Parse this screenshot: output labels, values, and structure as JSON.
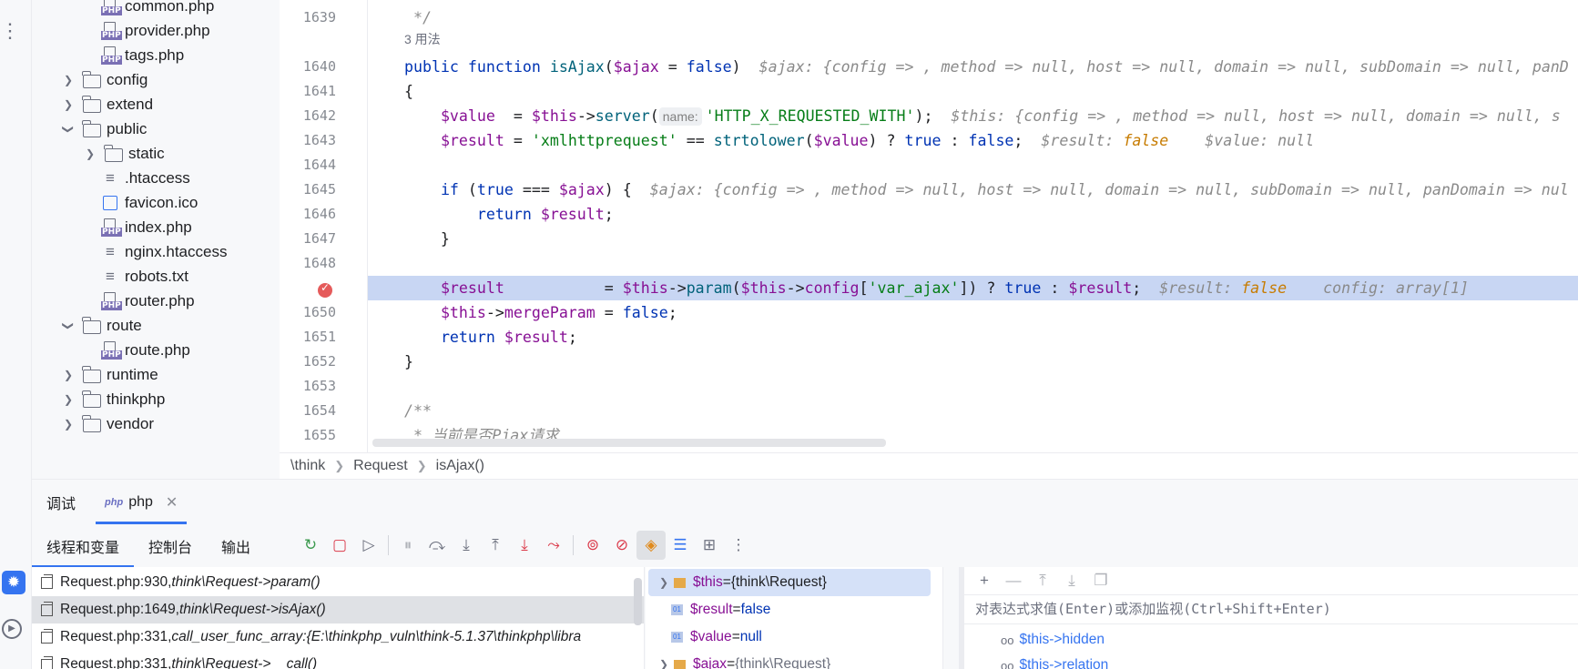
{
  "tree": {
    "items": [
      {
        "label": "common.php",
        "type": "php"
      },
      {
        "label": "provider.php",
        "type": "php"
      },
      {
        "label": "tags.php",
        "type": "php"
      },
      {
        "label": "config",
        "type": "folder"
      },
      {
        "label": "extend",
        "type": "folder"
      },
      {
        "label": "public",
        "type": "folder",
        "expanded": true
      },
      {
        "label": "static",
        "type": "folder"
      },
      {
        "label": ".htaccess",
        "type": "text"
      },
      {
        "label": "favicon.ico",
        "type": "image"
      },
      {
        "label": "index.php",
        "type": "php"
      },
      {
        "label": "nginx.htaccess",
        "type": "text"
      },
      {
        "label": "robots.txt",
        "type": "text"
      },
      {
        "label": "router.php",
        "type": "php"
      },
      {
        "label": "route",
        "type": "folder",
        "expanded": true
      },
      {
        "label": "route.php",
        "type": "php"
      },
      {
        "label": "runtime",
        "type": "folder"
      },
      {
        "label": "thinkphp",
        "type": "folder"
      },
      {
        "label": "vendor",
        "type": "folder"
      }
    ],
    "php_badge": "PHP"
  },
  "editor": {
    "line_numbers": [
      "1639",
      "1640",
      "1641",
      "1642",
      "1643",
      "1644",
      "1645",
      "1646",
      "1647",
      "1648",
      "1649",
      "1650",
      "1651",
      "1652",
      "1653",
      "1654",
      "1655"
    ],
    "usage_hint": "3 用法",
    "name_hint": "name:",
    "inline": {
      "l1640": "$ajax: {config => , method => null, host => null, domain => null, subDomain => null, panD",
      "l1642": "$this: {config => , method => null, host => null, domain => null, s",
      "l1643_result": "$result: ",
      "l1643_result_val": "false",
      "l1643_value": "$value: null",
      "l1645": "$ajax: {config => , method => null, host => null, domain => null, subDomain => null, panDomain => nul",
      "l1649_result": "$result: ",
      "l1649_result_val": "false",
      "l1649_config": "config: array[1]"
    },
    "comment_1655": " * 当前是否Pjax请求"
  },
  "breadcrumb": [
    "\\think",
    "Request",
    "isAjax()"
  ],
  "debug": {
    "tab_debug": "调试",
    "tab_php": "php",
    "php_logo": "php",
    "subtabs": [
      "线程和变量",
      "控制台",
      "输出"
    ],
    "frames": [
      {
        "loc": "Request.php:930, ",
        "fn": "think\\Request->param()"
      },
      {
        "loc": "Request.php:1649, ",
        "fn": "think\\Request->isAjax()"
      },
      {
        "loc": "Request.php:331, ",
        "fn": "call_user_func_array:{E:\\thinkphp_vuln\\think-5.1.37\\thinkphp\\libra"
      },
      {
        "loc": "Request.php:331, ",
        "fn": "think\\Request->__call()"
      }
    ],
    "variables": [
      {
        "name": "$this",
        "eq": " = ",
        "value": "{think\\Request}"
      },
      {
        "name": "$result",
        "eq": " = ",
        "value": "false"
      },
      {
        "name": "$value",
        "eq": " = ",
        "value": "null"
      },
      {
        "name": "$ajax",
        "eq": " = ",
        "value": "{think\\Request}"
      }
    ],
    "var_badge": "01",
    "watch_placeholder": "对表达式求值(Enter)或添加监视(Ctrl+Shift+Enter)",
    "watches": [
      "$this->hidden",
      "$this->relation"
    ]
  },
  "colors": {
    "accent": "#3574f0",
    "highlight_line": "#c8d6f3",
    "breakpoint": "#e55b5b"
  }
}
